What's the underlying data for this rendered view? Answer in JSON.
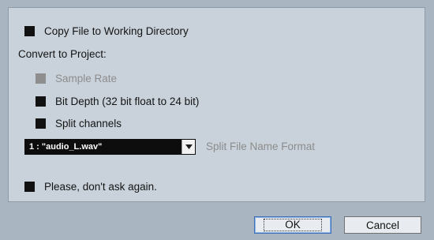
{
  "options": {
    "copy_file": {
      "label": "Copy File to Working Directory",
      "checked": true
    },
    "convert_heading": "Convert to Project:",
    "sample_rate": {
      "label": "Sample Rate",
      "checked": true,
      "enabled": false
    },
    "bit_depth": {
      "label": "Bit Depth (32 bit float to 24 bit)",
      "checked": true
    },
    "split_channels": {
      "label": "Split channels",
      "checked": true
    },
    "split_format": {
      "selected": "1 : \"audio_L.wav\"",
      "label": "Split File Name Format"
    },
    "dont_ask": {
      "label": "Please, don't ask again.",
      "checked": true
    }
  },
  "buttons": {
    "ok": "OK",
    "cancel": "Cancel"
  },
  "icons": {
    "dropdown": "chevron-down-icon"
  },
  "colors": {
    "panel_bg": "#c9d2db",
    "dialog_bg": "#a9b5c1",
    "checkbox_fill": "#111111",
    "disabled_text": "#8c8c8c"
  }
}
